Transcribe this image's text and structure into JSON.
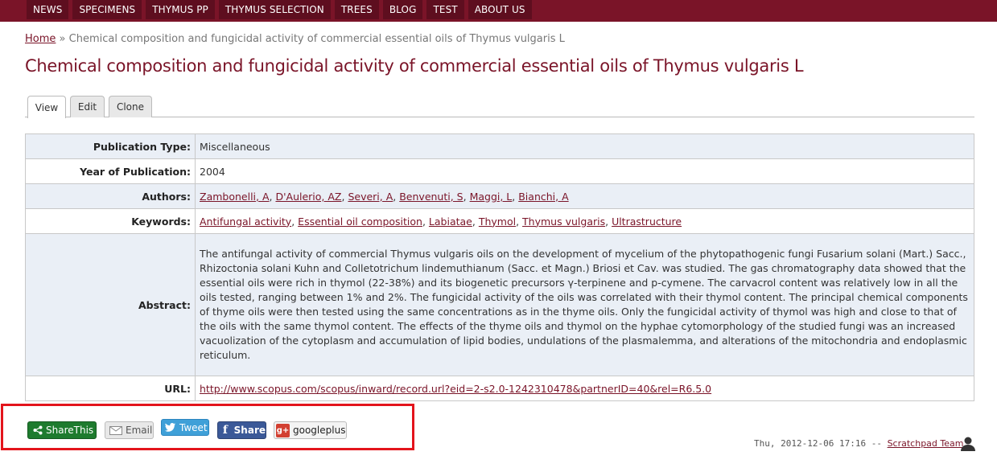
{
  "nav": {
    "items": [
      "NEWS",
      "SPECIMENS",
      "THYMUS PP",
      "THYMUS SELECTION",
      "TREES",
      "BLOG",
      "TEST",
      "ABOUT US"
    ]
  },
  "breadcrumb": {
    "home": "Home",
    "separator": "»",
    "current": "Chemical composition and fungicidal activity of commercial essential oils of Thymus vulgaris L"
  },
  "page": {
    "title": "Chemical composition and fungicidal activity of commercial essential oils of Thymus vulgaris L"
  },
  "tabs": {
    "view": "View",
    "edit": "Edit",
    "clone": "Clone"
  },
  "fields": {
    "publication_type_label": "Publication Type:",
    "publication_type": "Miscellaneous",
    "year_label": "Year of Publication:",
    "year": "2004",
    "authors_label": "Authors:",
    "authors": [
      "Zambonelli, A",
      "D'Aulerio, AZ",
      "Severi, A",
      "Benvenuti, S",
      "Maggi, L",
      "Bianchi, A"
    ],
    "keywords_label": "Keywords:",
    "keywords": [
      "Antifungal activity",
      "Essential oil composition",
      "Labiatae",
      "Thymol",
      "Thymus vulgaris",
      "Ultrastructure"
    ],
    "abstract_label": "Abstract:",
    "abstract_lines": [
      "The antifungal activity of commercial Thymus vulgaris oils on the development of mycelium of the phytopathogenic fungi Fusarium solani (Mart.) Sacc.,",
      "Rhizoctonia solani Kuhn and Colletotrichum lindemuthianum (Sacc. et Magn.) Briosi et Cav. was studied. The gas chromatography data showed that the",
      "essential oils were rich in thymol (22-38%) and its biogenetic precursors γ-terpinene and p-cymene. The carvacrol content was relatively low in all the",
      "oils tested, ranging between 1% and 2%. The fungicidal activity of the oils was correlated with their thymol content. The principal chemical components",
      "of thyme oils were then tested using the same concentrations as in the thyme oils. Only the fungicidal activity of thymol was high and close to that of",
      "the oils with the same thymol content. The effects of the thyme oils and thymol on the hyphae cytomorphology of the studied fungi was an increased",
      "vacuolization of the cytoplasm and accumulation of lipid bodies, undulations of the plasmalemma, and alterations of the mitochondria and endoplasmic",
      "reticulum."
    ],
    "url_label": "URL:",
    "url": "http://www.scopus.com/scopus/inward/record.url?eid=2-s2.0-1242310478&partnerID=40&rel=R6.5.0"
  },
  "share": {
    "sharethis": "ShareThis",
    "email": "Email",
    "tweet": "Tweet",
    "facebook": "Share",
    "googleplus": "googleplus",
    "gplus_badge": "g+",
    "fb_badge": "f"
  },
  "meta": {
    "date": "Thu, 2012-12-06 17:16",
    "separator": "--",
    "author": "Scratchpad Team"
  },
  "colors": {
    "brand": "#7a1428",
    "nav_item": "#5e0e1f",
    "row_shade": "#eaeff6",
    "highlight_box": "#e3141c"
  },
  "icons": [
    "share-icon",
    "email-icon",
    "twitter-bird-icon",
    "facebook-icon",
    "googleplus-icon",
    "user-icon"
  ]
}
